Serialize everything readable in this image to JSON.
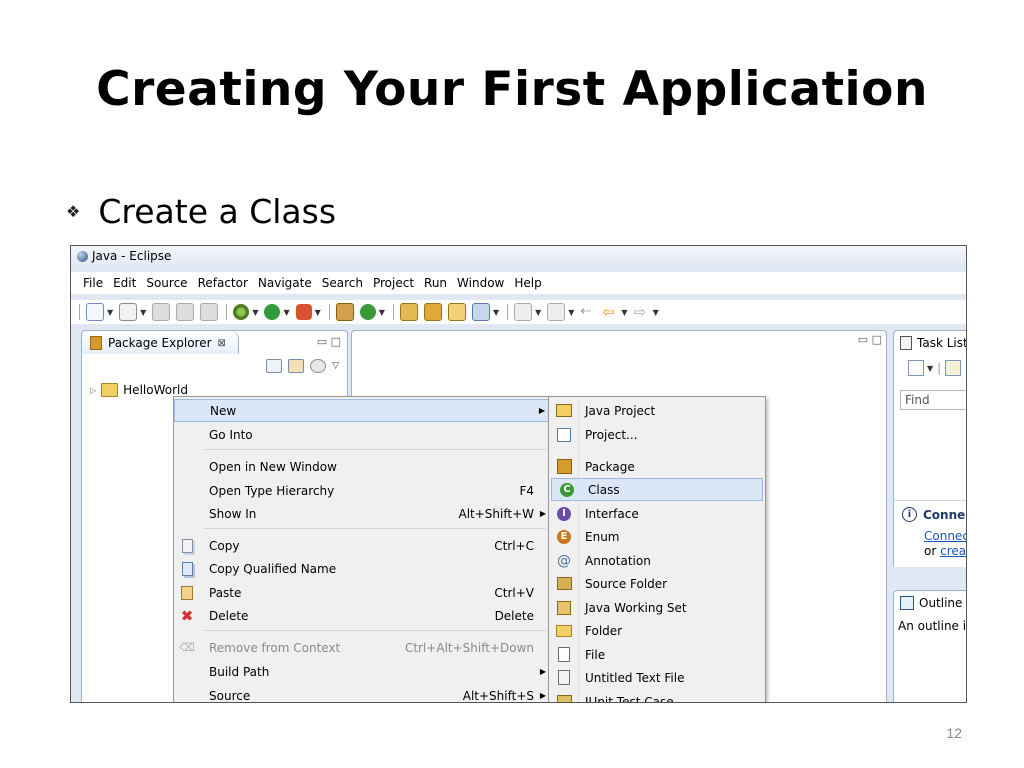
{
  "slide": {
    "title": "Creating Your First Application",
    "bullet": "Create a Class",
    "page_number": "12"
  },
  "window": {
    "title": "Java - Eclipse"
  },
  "menubar": [
    "File",
    "Edit",
    "Source",
    "Refactor",
    "Navigate",
    "Search",
    "Project",
    "Run",
    "Window",
    "Help"
  ],
  "package_explorer": {
    "tab_label": "Package Explorer",
    "tab_close": "⊠",
    "tree": {
      "project": "HelloWorld"
    }
  },
  "task_list": {
    "tab_label": "Task List",
    "find_placeholder": "Find",
    "connect_heading": "Conne",
    "connect_link": "Connec",
    "connect_or": "or",
    "create_link": "creat"
  },
  "outline": {
    "tab_label": "Outline",
    "message": "An outline i"
  },
  "context_menu": {
    "items": [
      {
        "label": "New",
        "shortcut": "",
        "submenu": true,
        "icon": ""
      },
      {
        "label": "Go Into",
        "shortcut": "",
        "submenu": false,
        "icon": ""
      },
      {
        "label": "Open in New Window",
        "shortcut": "",
        "submenu": false,
        "icon": ""
      },
      {
        "label": "Open Type Hierarchy",
        "shortcut": "F4",
        "submenu": false,
        "icon": ""
      },
      {
        "label": "Show In",
        "shortcut": "Alt+Shift+W",
        "submenu": true,
        "icon": ""
      },
      {
        "label": "Copy",
        "shortcut": "Ctrl+C",
        "submenu": false,
        "icon": "copy-icon"
      },
      {
        "label": "Copy Qualified Name",
        "shortcut": "",
        "submenu": false,
        "icon": "copy-qualified-icon"
      },
      {
        "label": "Paste",
        "shortcut": "Ctrl+V",
        "submenu": false,
        "icon": "paste-icon"
      },
      {
        "label": "Delete",
        "shortcut": "Delete",
        "submenu": false,
        "icon": "delete-icon"
      },
      {
        "label": "Remove from Context",
        "shortcut": "Ctrl+Alt+Shift+Down",
        "submenu": false,
        "icon": "remove-context-icon"
      },
      {
        "label": "Build Path",
        "shortcut": "",
        "submenu": true,
        "icon": ""
      },
      {
        "label": "Source",
        "shortcut": "Alt+Shift+S",
        "submenu": true,
        "icon": ""
      }
    ]
  },
  "new_submenu": {
    "items": [
      {
        "label": "Java Project",
        "icon": "java-project-icon"
      },
      {
        "label": "Project...",
        "icon": "project-icon"
      },
      {
        "label": "Package",
        "icon": "package-icon"
      },
      {
        "label": "Class",
        "icon": "class-icon"
      },
      {
        "label": "Interface",
        "icon": "interface-icon"
      },
      {
        "label": "Enum",
        "icon": "enum-icon"
      },
      {
        "label": "Annotation",
        "icon": "annotation-icon"
      },
      {
        "label": "Source Folder",
        "icon": "source-folder-icon"
      },
      {
        "label": "Java Working Set",
        "icon": "working-set-icon"
      },
      {
        "label": "Folder",
        "icon": "folder-icon"
      },
      {
        "label": "File",
        "icon": "file-icon"
      },
      {
        "label": "Untitled Text File",
        "icon": "text-file-icon"
      },
      {
        "label": "JUnit Test Case",
        "icon": "junit-icon"
      }
    ]
  },
  "colors": {
    "highlight": "#dbe7f7",
    "class_icon": "#3a9a3a",
    "link": "#1a55b8"
  }
}
